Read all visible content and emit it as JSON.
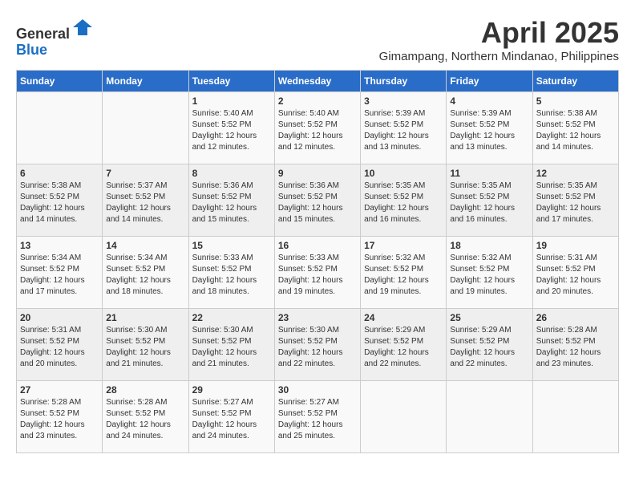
{
  "header": {
    "logo_line1": "General",
    "logo_line2": "Blue",
    "month_title": "April 2025",
    "location": "Gimampang, Northern Mindanao, Philippines"
  },
  "weekdays": [
    "Sunday",
    "Monday",
    "Tuesday",
    "Wednesday",
    "Thursday",
    "Friday",
    "Saturday"
  ],
  "weeks": [
    [
      {
        "day": "",
        "sunrise": "",
        "sunset": "",
        "daylight": ""
      },
      {
        "day": "",
        "sunrise": "",
        "sunset": "",
        "daylight": ""
      },
      {
        "day": "1",
        "sunrise": "Sunrise: 5:40 AM",
        "sunset": "Sunset: 5:52 PM",
        "daylight": "Daylight: 12 hours and 12 minutes."
      },
      {
        "day": "2",
        "sunrise": "Sunrise: 5:40 AM",
        "sunset": "Sunset: 5:52 PM",
        "daylight": "Daylight: 12 hours and 12 minutes."
      },
      {
        "day": "3",
        "sunrise": "Sunrise: 5:39 AM",
        "sunset": "Sunset: 5:52 PM",
        "daylight": "Daylight: 12 hours and 13 minutes."
      },
      {
        "day": "4",
        "sunrise": "Sunrise: 5:39 AM",
        "sunset": "Sunset: 5:52 PM",
        "daylight": "Daylight: 12 hours and 13 minutes."
      },
      {
        "day": "5",
        "sunrise": "Sunrise: 5:38 AM",
        "sunset": "Sunset: 5:52 PM",
        "daylight": "Daylight: 12 hours and 14 minutes."
      }
    ],
    [
      {
        "day": "6",
        "sunrise": "Sunrise: 5:38 AM",
        "sunset": "Sunset: 5:52 PM",
        "daylight": "Daylight: 12 hours and 14 minutes."
      },
      {
        "day": "7",
        "sunrise": "Sunrise: 5:37 AM",
        "sunset": "Sunset: 5:52 PM",
        "daylight": "Daylight: 12 hours and 14 minutes."
      },
      {
        "day": "8",
        "sunrise": "Sunrise: 5:36 AM",
        "sunset": "Sunset: 5:52 PM",
        "daylight": "Daylight: 12 hours and 15 minutes."
      },
      {
        "day": "9",
        "sunrise": "Sunrise: 5:36 AM",
        "sunset": "Sunset: 5:52 PM",
        "daylight": "Daylight: 12 hours and 15 minutes."
      },
      {
        "day": "10",
        "sunrise": "Sunrise: 5:35 AM",
        "sunset": "Sunset: 5:52 PM",
        "daylight": "Daylight: 12 hours and 16 minutes."
      },
      {
        "day": "11",
        "sunrise": "Sunrise: 5:35 AM",
        "sunset": "Sunset: 5:52 PM",
        "daylight": "Daylight: 12 hours and 16 minutes."
      },
      {
        "day": "12",
        "sunrise": "Sunrise: 5:35 AM",
        "sunset": "Sunset: 5:52 PM",
        "daylight": "Daylight: 12 hours and 17 minutes."
      }
    ],
    [
      {
        "day": "13",
        "sunrise": "Sunrise: 5:34 AM",
        "sunset": "Sunset: 5:52 PM",
        "daylight": "Daylight: 12 hours and 17 minutes."
      },
      {
        "day": "14",
        "sunrise": "Sunrise: 5:34 AM",
        "sunset": "Sunset: 5:52 PM",
        "daylight": "Daylight: 12 hours and 18 minutes."
      },
      {
        "day": "15",
        "sunrise": "Sunrise: 5:33 AM",
        "sunset": "Sunset: 5:52 PM",
        "daylight": "Daylight: 12 hours and 18 minutes."
      },
      {
        "day": "16",
        "sunrise": "Sunrise: 5:33 AM",
        "sunset": "Sunset: 5:52 PM",
        "daylight": "Daylight: 12 hours and 19 minutes."
      },
      {
        "day": "17",
        "sunrise": "Sunrise: 5:32 AM",
        "sunset": "Sunset: 5:52 PM",
        "daylight": "Daylight: 12 hours and 19 minutes."
      },
      {
        "day": "18",
        "sunrise": "Sunrise: 5:32 AM",
        "sunset": "Sunset: 5:52 PM",
        "daylight": "Daylight: 12 hours and 19 minutes."
      },
      {
        "day": "19",
        "sunrise": "Sunrise: 5:31 AM",
        "sunset": "Sunset: 5:52 PM",
        "daylight": "Daylight: 12 hours and 20 minutes."
      }
    ],
    [
      {
        "day": "20",
        "sunrise": "Sunrise: 5:31 AM",
        "sunset": "Sunset: 5:52 PM",
        "daylight": "Daylight: 12 hours and 20 minutes."
      },
      {
        "day": "21",
        "sunrise": "Sunrise: 5:30 AM",
        "sunset": "Sunset: 5:52 PM",
        "daylight": "Daylight: 12 hours and 21 minutes."
      },
      {
        "day": "22",
        "sunrise": "Sunrise: 5:30 AM",
        "sunset": "Sunset: 5:52 PM",
        "daylight": "Daylight: 12 hours and 21 minutes."
      },
      {
        "day": "23",
        "sunrise": "Sunrise: 5:30 AM",
        "sunset": "Sunset: 5:52 PM",
        "daylight": "Daylight: 12 hours and 22 minutes."
      },
      {
        "day": "24",
        "sunrise": "Sunrise: 5:29 AM",
        "sunset": "Sunset: 5:52 PM",
        "daylight": "Daylight: 12 hours and 22 minutes."
      },
      {
        "day": "25",
        "sunrise": "Sunrise: 5:29 AM",
        "sunset": "Sunset: 5:52 PM",
        "daylight": "Daylight: 12 hours and 22 minutes."
      },
      {
        "day": "26",
        "sunrise": "Sunrise: 5:28 AM",
        "sunset": "Sunset: 5:52 PM",
        "daylight": "Daylight: 12 hours and 23 minutes."
      }
    ],
    [
      {
        "day": "27",
        "sunrise": "Sunrise: 5:28 AM",
        "sunset": "Sunset: 5:52 PM",
        "daylight": "Daylight: 12 hours and 23 minutes."
      },
      {
        "day": "28",
        "sunrise": "Sunrise: 5:28 AM",
        "sunset": "Sunset: 5:52 PM",
        "daylight": "Daylight: 12 hours and 24 minutes."
      },
      {
        "day": "29",
        "sunrise": "Sunrise: 5:27 AM",
        "sunset": "Sunset: 5:52 PM",
        "daylight": "Daylight: 12 hours and 24 minutes."
      },
      {
        "day": "30",
        "sunrise": "Sunrise: 5:27 AM",
        "sunset": "Sunset: 5:52 PM",
        "daylight": "Daylight: 12 hours and 25 minutes."
      },
      {
        "day": "",
        "sunrise": "",
        "sunset": "",
        "daylight": ""
      },
      {
        "day": "",
        "sunrise": "",
        "sunset": "",
        "daylight": ""
      },
      {
        "day": "",
        "sunrise": "",
        "sunset": "",
        "daylight": ""
      }
    ]
  ]
}
